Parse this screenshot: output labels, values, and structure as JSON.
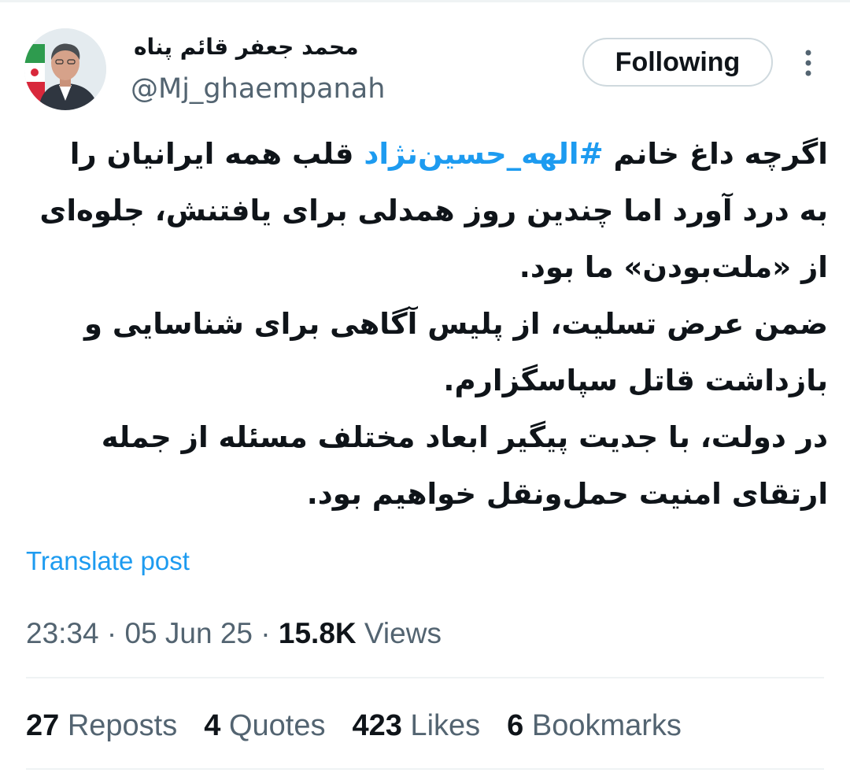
{
  "author": {
    "display_name": "محمد جعفر قائم پناه",
    "handle": "@Mj_ghaempanah",
    "avatar_icon": "portrait-photo"
  },
  "follow_button": {
    "label": "Following"
  },
  "more_menu": {
    "icon": "more-vertical-icon"
  },
  "tweet": {
    "lines": [
      {
        "before": "اگرچه داغ خانم ",
        "hashtag": "#الهه_حسین‌نژاد",
        "after": " قلب همه ایرانیان را"
      },
      {
        "text": "به درد آورد اما چندین روز همدلی برای یافتنش، جلوه‌ای"
      },
      {
        "text": "از «ملت‌بودن» ما بود."
      },
      {
        "text": "ضمن عرض تسلیت، از پلیس آگاهی برای شناسایی و"
      },
      {
        "text": "بازداشت قاتل سپاسگزارم."
      },
      {
        "text": "در دولت، با جدیت پیگیر ابعاد مختلف مسئله از جمله"
      },
      {
        "text": "ارتقای امنیت حمل‌ونقل خواهیم بود."
      }
    ]
  },
  "translate_link": "Translate post",
  "meta": {
    "time": "23:34",
    "sep1": " · ",
    "date": "05 Jun 25",
    "sep2": " · ",
    "views_count": "15.8K",
    "views_label": " Views"
  },
  "stats": {
    "reposts": {
      "count": "27",
      "label": " Reposts"
    },
    "quotes": {
      "count": "4",
      "label": " Quotes"
    },
    "likes": {
      "count": "423",
      "label": " Likes"
    },
    "bookmarks": {
      "count": "6",
      "label": " Bookmarks"
    }
  },
  "colors": {
    "accent": "#1d9bf0",
    "text": "#0f1419",
    "secondary": "#536471",
    "divider": "#eff3f4"
  }
}
